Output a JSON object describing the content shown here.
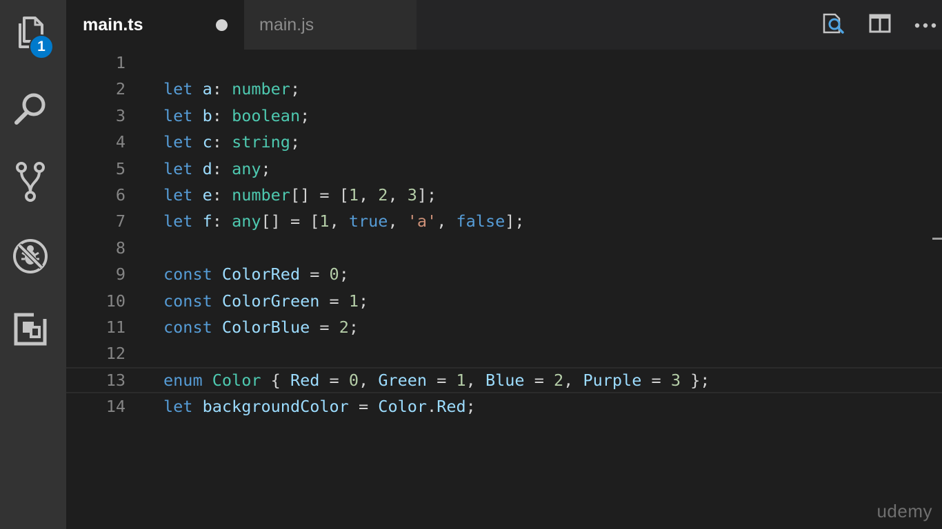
{
  "activity_bar": {
    "explorer_badge": "1"
  },
  "tabs": [
    {
      "label": "main.ts",
      "active": true,
      "dirty": true
    },
    {
      "label": "main.js",
      "active": false,
      "dirty": false
    }
  ],
  "code_lines": [
    {
      "num": "1",
      "tokens": []
    },
    {
      "num": "2",
      "tokens": [
        [
          "kw",
          "let"
        ],
        [
          "pn",
          " "
        ],
        [
          "vr",
          "a"
        ],
        [
          "pn",
          ": "
        ],
        [
          "ty",
          "number"
        ],
        [
          "pn",
          ";"
        ]
      ]
    },
    {
      "num": "3",
      "tokens": [
        [
          "kw",
          "let"
        ],
        [
          "pn",
          " "
        ],
        [
          "vr",
          "b"
        ],
        [
          "pn",
          ": "
        ],
        [
          "ty",
          "boolean"
        ],
        [
          "pn",
          ";"
        ]
      ]
    },
    {
      "num": "4",
      "tokens": [
        [
          "kw",
          "let"
        ],
        [
          "pn",
          " "
        ],
        [
          "vr",
          "c"
        ],
        [
          "pn",
          ": "
        ],
        [
          "ty",
          "string"
        ],
        [
          "pn",
          ";"
        ]
      ]
    },
    {
      "num": "5",
      "tokens": [
        [
          "kw",
          "let"
        ],
        [
          "pn",
          " "
        ],
        [
          "vr",
          "d"
        ],
        [
          "pn",
          ": "
        ],
        [
          "ty",
          "any"
        ],
        [
          "pn",
          ";"
        ]
      ]
    },
    {
      "num": "6",
      "tokens": [
        [
          "kw",
          "let"
        ],
        [
          "pn",
          " "
        ],
        [
          "vr",
          "e"
        ],
        [
          "pn",
          ": "
        ],
        [
          "ty",
          "number"
        ],
        [
          "pn",
          "[] = ["
        ],
        [
          "nm",
          "1"
        ],
        [
          "pn",
          ", "
        ],
        [
          "nm",
          "2"
        ],
        [
          "pn",
          ", "
        ],
        [
          "nm",
          "3"
        ],
        [
          "pn",
          "];"
        ]
      ]
    },
    {
      "num": "7",
      "tokens": [
        [
          "kw",
          "let"
        ],
        [
          "pn",
          " "
        ],
        [
          "vr",
          "f"
        ],
        [
          "pn",
          ": "
        ],
        [
          "ty",
          "any"
        ],
        [
          "pn",
          "[] = ["
        ],
        [
          "nm",
          "1"
        ],
        [
          "pn",
          ", "
        ],
        [
          "kw",
          "true"
        ],
        [
          "pn",
          ", "
        ],
        [
          "st",
          "'a'"
        ],
        [
          "pn",
          ", "
        ],
        [
          "kw",
          "false"
        ],
        [
          "pn",
          "];"
        ]
      ]
    },
    {
      "num": "8",
      "tokens": []
    },
    {
      "num": "9",
      "tokens": [
        [
          "kw",
          "const"
        ],
        [
          "pn",
          " "
        ],
        [
          "vr",
          "ColorRed"
        ],
        [
          "pn",
          " = "
        ],
        [
          "nm",
          "0"
        ],
        [
          "pn",
          ";"
        ]
      ]
    },
    {
      "num": "10",
      "tokens": [
        [
          "kw",
          "const"
        ],
        [
          "pn",
          " "
        ],
        [
          "vr",
          "ColorGreen"
        ],
        [
          "pn",
          " = "
        ],
        [
          "nm",
          "1"
        ],
        [
          "pn",
          ";"
        ]
      ]
    },
    {
      "num": "11",
      "tokens": [
        [
          "kw",
          "const"
        ],
        [
          "pn",
          " "
        ],
        [
          "vr",
          "ColorBlue"
        ],
        [
          "pn",
          " = "
        ],
        [
          "nm",
          "2"
        ],
        [
          "pn",
          ";"
        ]
      ]
    },
    {
      "num": "12",
      "tokens": []
    },
    {
      "num": "13",
      "tokens": [
        [
          "kw",
          "enum"
        ],
        [
          "pn",
          " "
        ],
        [
          "ty",
          "Color"
        ],
        [
          "pn",
          " { "
        ],
        [
          "vr",
          "Red"
        ],
        [
          "pn",
          " = "
        ],
        [
          "nm",
          "0"
        ],
        [
          "pn",
          ", "
        ],
        [
          "vr",
          "Green"
        ],
        [
          "pn",
          " = "
        ],
        [
          "nm",
          "1"
        ],
        [
          "pn",
          ", "
        ],
        [
          "vr",
          "Blue"
        ],
        [
          "pn",
          " = "
        ],
        [
          "nm",
          "2"
        ],
        [
          "pn",
          ", "
        ],
        [
          "vr",
          "Purple"
        ],
        [
          "pn",
          " = "
        ],
        [
          "nm",
          "3"
        ],
        [
          "pn",
          " };"
        ]
      ],
      "current": true
    },
    {
      "num": "14",
      "tokens": [
        [
          "kw",
          "let"
        ],
        [
          "pn",
          " "
        ],
        [
          "vr",
          "backgroundColor"
        ],
        [
          "pn",
          " = "
        ],
        [
          "vr",
          "Color"
        ],
        [
          "pn",
          "."
        ],
        [
          "vr",
          "Red"
        ],
        [
          "pn",
          ";"
        ]
      ]
    }
  ],
  "watermark": "udemy",
  "icons": {
    "activity": [
      "files-icon",
      "search-icon",
      "source-control-icon",
      "debug-icon",
      "extensions-icon"
    ],
    "tab_actions": [
      "open-preview-icon",
      "split-editor-icon",
      "more-actions-icon"
    ]
  },
  "colors": {
    "keyword": "#569cd6",
    "type": "#4ec9b0",
    "variable": "#9cdcfe",
    "number": "#b5cea8",
    "string": "#ce9178",
    "accent": "#007acc"
  }
}
